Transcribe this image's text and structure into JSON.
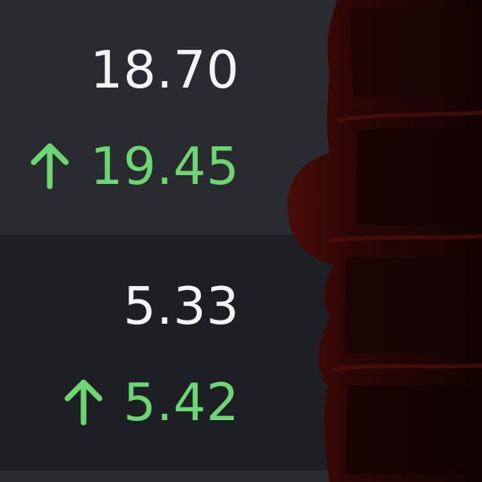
{
  "rows": [
    {
      "current": "18.70",
      "target": "19.45",
      "direction": "up"
    },
    {
      "current": "5.33",
      "target": "5.42",
      "direction": "up"
    }
  ],
  "colors": {
    "background_row_light": "#2a2b30",
    "background_row_dark": "#1e1f24",
    "value_text": "#f4f4f4",
    "positive": "#6bd672",
    "overlay_red": "#3a0906"
  },
  "icons": {
    "up": "arrow-up-icon"
  }
}
